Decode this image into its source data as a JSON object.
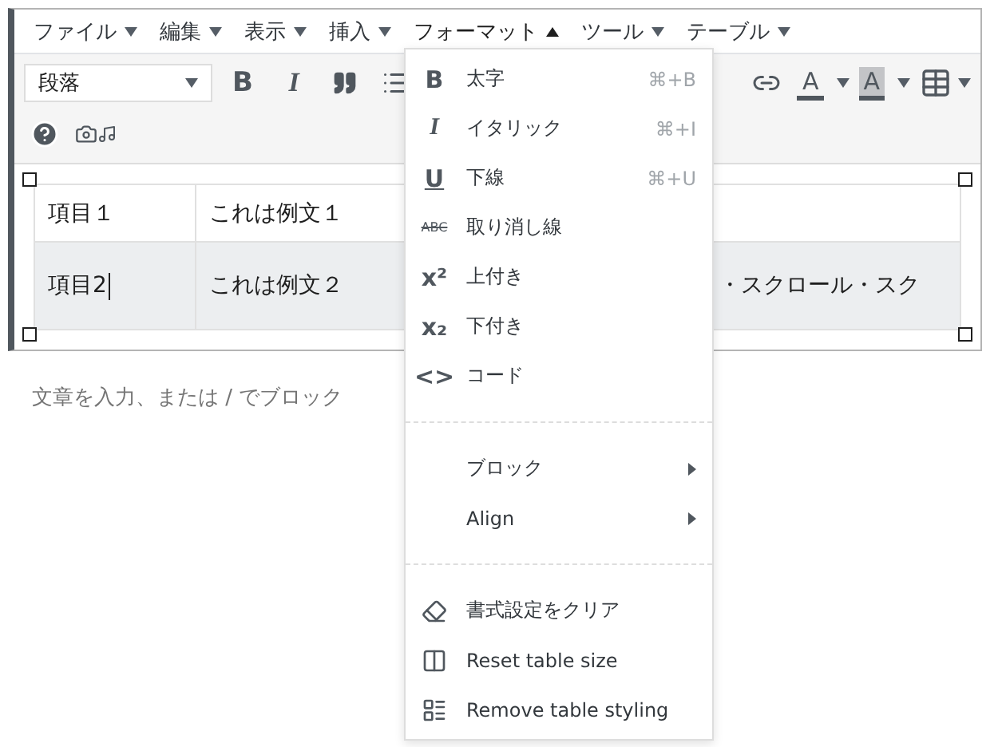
{
  "menubar": [
    {
      "label": "ファイル",
      "open": false
    },
    {
      "label": "編集",
      "open": false
    },
    {
      "label": "表示",
      "open": false
    },
    {
      "label": "挿入",
      "open": false
    },
    {
      "label": "フォーマット",
      "open": true
    },
    {
      "label": "ツール",
      "open": false
    },
    {
      "label": "テーブル",
      "open": false
    }
  ],
  "toolbar": {
    "format_select": "段落",
    "glyph_buttons": [
      "B",
      "I"
    ],
    "color_buttons": [
      {
        "glyph": "A",
        "kind": "text"
      },
      {
        "glyph": "A",
        "kind": "background"
      }
    ]
  },
  "table": {
    "rows": [
      {
        "cells": [
          "項目１",
          "これは例文１",
          ""
        ],
        "selected": false
      },
      {
        "cells": [
          "項目2",
          "これは例文２",
          "・スクロール・スク"
        ],
        "selected": true
      }
    ]
  },
  "placeholder": "文章を入力、または / でブロック",
  "format_menu": [
    {
      "kind": "command",
      "glyph": "B",
      "label": "太字",
      "shortcut": "⌘+B"
    },
    {
      "kind": "command",
      "glyph": "I",
      "label": "イタリック",
      "shortcut": "⌘+I"
    },
    {
      "kind": "command",
      "glyph": "U",
      "label": "下線",
      "shortcut": "⌘+U"
    },
    {
      "kind": "command",
      "glyph": "ABC",
      "label": "取り消し線"
    },
    {
      "kind": "command",
      "glyph": "x²",
      "label": "上付き"
    },
    {
      "kind": "command",
      "glyph": "x₂",
      "label": "下付き"
    },
    {
      "kind": "command",
      "glyph": "<>",
      "label": "コード"
    },
    {
      "kind": "separator"
    },
    {
      "kind": "submenu",
      "label": "ブロック"
    },
    {
      "kind": "submenu",
      "label": "Align"
    },
    {
      "kind": "separator"
    },
    {
      "kind": "command",
      "label": "書式設定をクリア"
    },
    {
      "kind": "command",
      "label": "Reset table size"
    },
    {
      "kind": "command",
      "label": "Remove table styling"
    }
  ]
}
